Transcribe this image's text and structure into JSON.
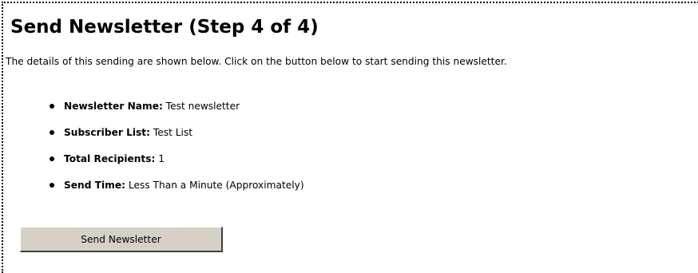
{
  "page": {
    "title": "Send Newsletter (Step 4 of 4)",
    "intro": "The details of this sending are shown below. Click on the button below to start sending this newsletter."
  },
  "details": [
    {
      "label": "Newsletter Name:",
      "value": "Test newsletter"
    },
    {
      "label": "Subscriber List:",
      "value": "Test List"
    },
    {
      "label": "Total Recipients:",
      "value": "1"
    },
    {
      "label": "Send Time:",
      "value": "Less Than a Minute (Approximately)"
    }
  ],
  "actions": {
    "send_label": "Send Newsletter"
  },
  "colors": {
    "button_face": "#d6d0c7",
    "text": "#000000",
    "background": "#ffffff"
  }
}
